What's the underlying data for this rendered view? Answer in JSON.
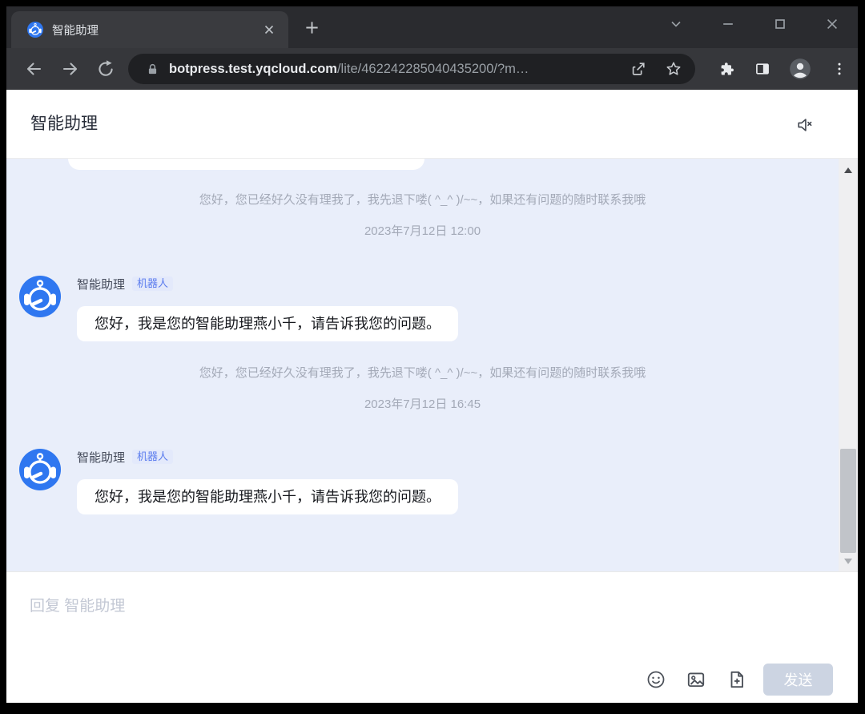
{
  "browser": {
    "tab_title": "智能助理",
    "url_host": "botpress.test.yqcloud.com",
    "url_path": "/lite/462242285040435200/?m…"
  },
  "page": {
    "header_title": "智能助理"
  },
  "chat": {
    "items": [
      {
        "type": "system",
        "text": "您好，您已经好久没有理我了，我先退下喽( ^_^ )/~~，如果还有问题的随时联系我哦"
      },
      {
        "type": "timestamp",
        "text": "2023年7月12日 12:00"
      },
      {
        "type": "bot",
        "name": "智能助理",
        "badge": "机器人",
        "text": "您好，我是您的智能助理燕小千，请告诉我您的问题。"
      },
      {
        "type": "system",
        "text": "您好，您已经好久没有理我了，我先退下喽( ^_^ )/~~，如果还有问题的随时联系我哦"
      },
      {
        "type": "timestamp",
        "text": "2023年7月12日 16:45"
      },
      {
        "type": "bot",
        "name": "智能助理",
        "badge": "机器人",
        "text": "您好，我是您的智能助理燕小千，请告诉我您的问题。"
      }
    ]
  },
  "composer": {
    "placeholder": "回复 智能助理",
    "send_label": "发送"
  },
  "colors": {
    "avatar_blue": "#2f77f0",
    "chat_background": "#e9eefa",
    "badge_text": "#5b7cee",
    "badge_background": "#e3e9fb",
    "muted_text": "#a3a9b7",
    "send_button_background": "#ccd4e2",
    "send_button_text": "#ffffff"
  },
  "icons": {
    "tab_favicon": "robot-avatar",
    "tab_close": "close-x",
    "new_tab": "plus",
    "window_controls": [
      "chevron-down",
      "minimize",
      "maximize",
      "close"
    ],
    "nav": [
      "back-arrow",
      "forward-arrow",
      "reload"
    ],
    "omnibox": [
      "lock",
      "share",
      "bookmark-star"
    ],
    "browser_actions": [
      "extensions-puzzle",
      "side-panel",
      "profile-avatar",
      "menu-kebab"
    ],
    "page_header": [
      "speaker-muted"
    ],
    "composer": [
      "emoji-smiley",
      "image-picture",
      "file-add"
    ],
    "scrollbar": [
      "arrow-up",
      "thumb",
      "arrow-down"
    ]
  }
}
